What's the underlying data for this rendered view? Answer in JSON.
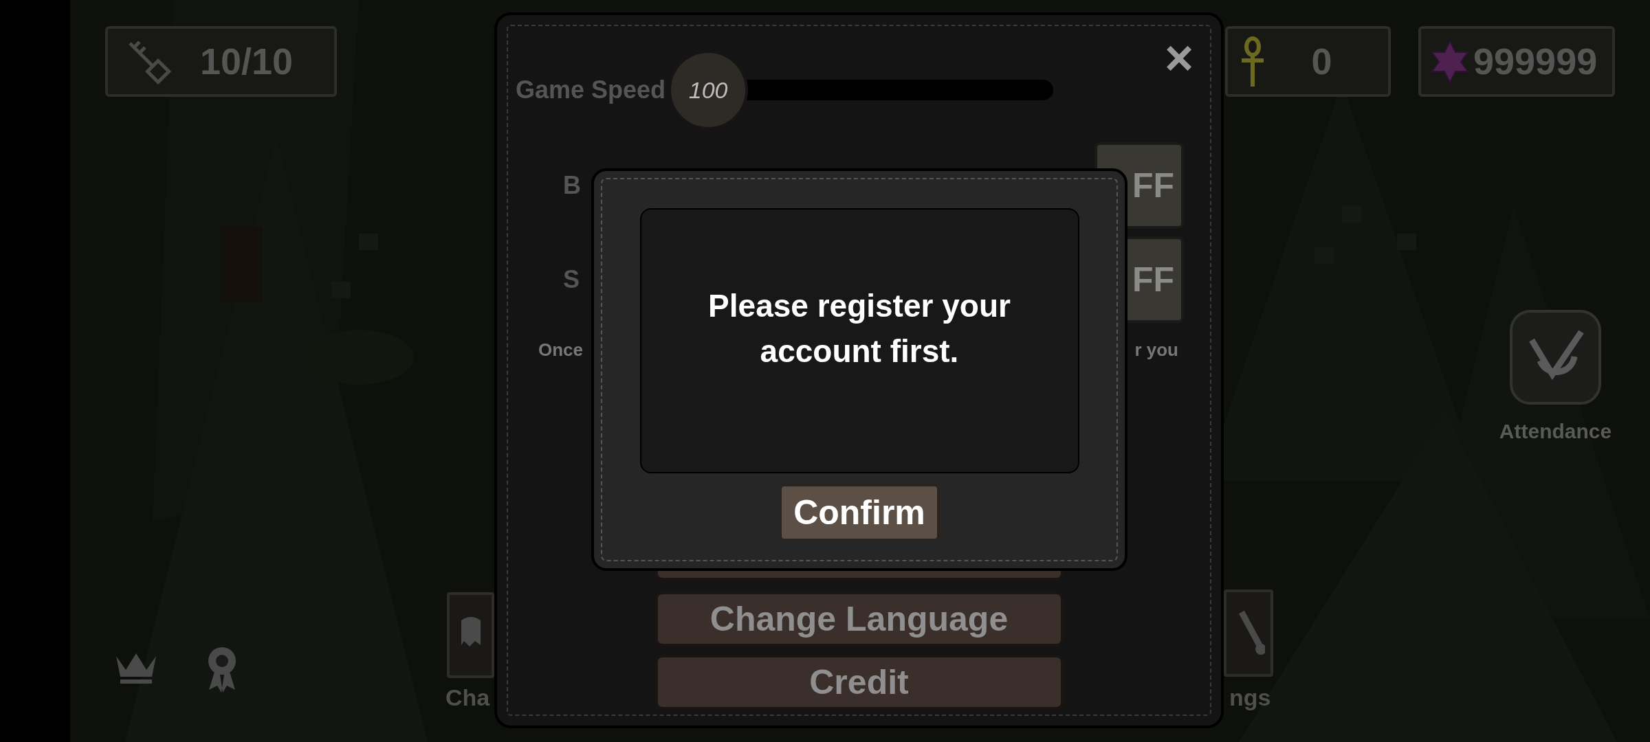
{
  "hud": {
    "keys": "10/10",
    "ankh": "0",
    "gems": "999999"
  },
  "side_buttons": [
    {
      "label": "Attendance"
    }
  ],
  "bottom_buttons": [
    {
      "label": "Cha"
    },
    {
      "label": "ngs"
    }
  ],
  "settings_panel": {
    "close": "×",
    "game_speed": {
      "label": "Game Speed",
      "value": "100",
      "level": 0
    },
    "rows": [
      {
        "label": "B",
        "toggle": "FF"
      },
      {
        "label": "S",
        "toggle": "FF"
      }
    ],
    "note_left": "Once",
    "note_right": "r you",
    "buttons": [
      "Change Language",
      "Credit"
    ]
  },
  "dialog": {
    "message": "Please register your account first.",
    "button": "Confirm"
  }
}
